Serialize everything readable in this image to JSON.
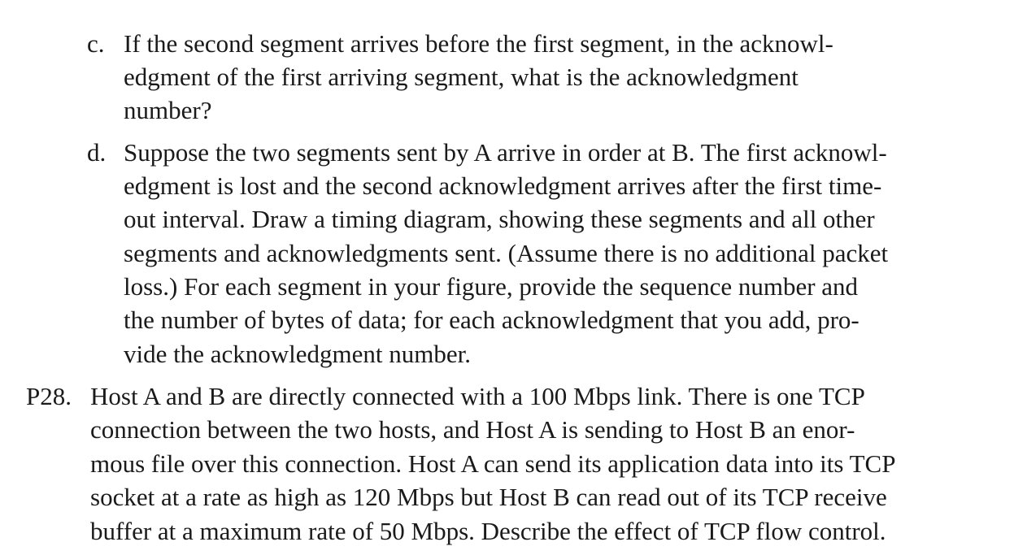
{
  "items": [
    {
      "marker": "c.",
      "lines": [
        "If the second segment arrives before the first segment, in the acknowl-",
        "edgment of the first arriving segment, what is the acknowledgment",
        "number?"
      ]
    },
    {
      "marker": "d.",
      "lines": [
        "Suppose the two segments sent by A arrive in order at B. The first acknowl-",
        "edgment is lost and the second acknowledgment arrives after the first time-",
        "out interval. Draw a timing diagram, showing these segments and all other",
        "segments and acknowledgments sent. (Assume there is no additional packet",
        "loss.) For each segment in your figure, provide the sequence number and",
        "the number of bytes of data; for each acknowledgment that you add, pro-",
        "vide the acknowledgment number."
      ]
    }
  ],
  "problem": {
    "marker": "P28.",
    "lines": [
      "Host A and B are directly connected with a 100 Mbps link. There is one TCP",
      "connection between the two hosts, and Host A is sending to Host B an enor-",
      "mous file over this connection. Host A can send its application data into its TCP",
      "socket at a rate as high as 120 Mbps but Host B can read out of its TCP receive",
      "buffer at a maximum rate of 50 Mbps. Describe the effect of TCP flow control."
    ]
  }
}
